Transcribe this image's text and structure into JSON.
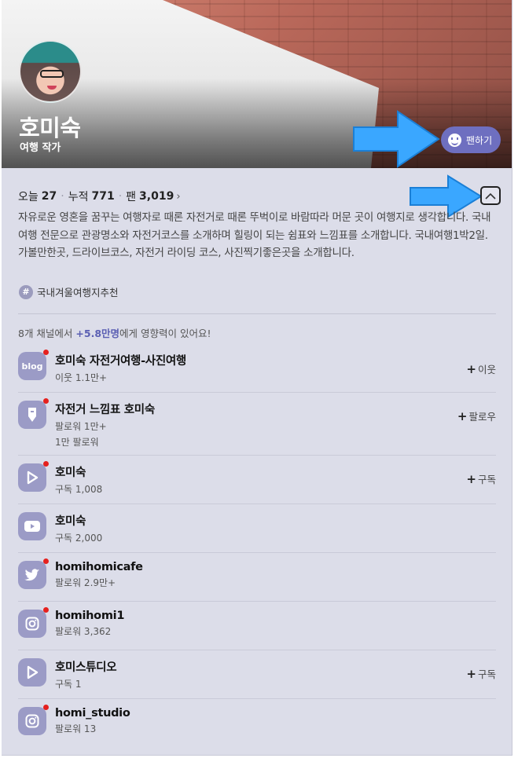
{
  "profile": {
    "name": "호미숙",
    "role": "여행 작가",
    "fan_button_label": "팬하기"
  },
  "stats": {
    "today_label": "오늘",
    "today_value": "27",
    "total_label": "누적",
    "total_value": "771",
    "fan_label": "팬",
    "fan_value": "3,019",
    "separator": "·",
    "chevron": "›"
  },
  "description": "자유로운 영혼을 꿈꾸는 여행자로 때론 자전거로 때론 뚜벅이로 바람따라 머문 곳이 여행지로 생각합니다. 국내여행 전문으로 관광명소와 자전거코스를 소개하며 힐링이 되는 쉼표와 느낌표를 소개합니다. 국내여행1박2일. 가볼만한곳, 드라이브코스, 자전거 라이딩 코스, 사진찍기좋은곳을 소개합니다.",
  "tag": {
    "hash": "#",
    "label": "국내겨울여행지추천"
  },
  "influence": {
    "prefix": "8개 채널에서 ",
    "highlight": "+5.8만명",
    "suffix": "에게 영향력이 있어요!"
  },
  "channels": [
    {
      "icon": "blog-icon",
      "icon_text": "blog",
      "title": "호미숙 자전거여행-사진여행",
      "sub": "이웃 1.1만+",
      "sub2": "",
      "action": "이웃"
    },
    {
      "icon": "post-icon",
      "icon_text": "",
      "title": "자전거 느낌표 호미숙",
      "sub": "팔로워 1만+",
      "sub2": "1만 팔로워",
      "action": "팔로우"
    },
    {
      "icon": "tv-play-icon",
      "icon_text": "",
      "title": "호미숙",
      "sub": "구독 1,008",
      "sub2": "",
      "action": "구독"
    },
    {
      "icon": "youtube-icon",
      "icon_text": "",
      "title": "호미숙",
      "sub": "구독 2,000",
      "sub2": "",
      "action": ""
    },
    {
      "icon": "twitter-icon",
      "icon_text": "",
      "title": "homihomicafe",
      "sub": "팔로워 2.9만+",
      "sub2": "",
      "action": ""
    },
    {
      "icon": "instagram-icon",
      "icon_text": "",
      "title": "homihomi1",
      "sub": "팔로워 3,362",
      "sub2": "",
      "action": ""
    },
    {
      "icon": "tv-play-icon",
      "icon_text": "",
      "title": "호미스튜디오",
      "sub": "구독 1",
      "sub2": "",
      "action": "구독"
    },
    {
      "icon": "instagram-icon",
      "icon_text": "",
      "title": "homi_studio",
      "sub": "팔로워 13",
      "sub2": "",
      "action": ""
    }
  ],
  "colors": {
    "card_bg": "#dcdde9",
    "accent": "#6e6fc0",
    "icon_bg": "#9b9bc6",
    "badge_red": "#e5201e",
    "highlight": "#5b5fb3",
    "annotation_arrow": "#3aa7ff"
  }
}
